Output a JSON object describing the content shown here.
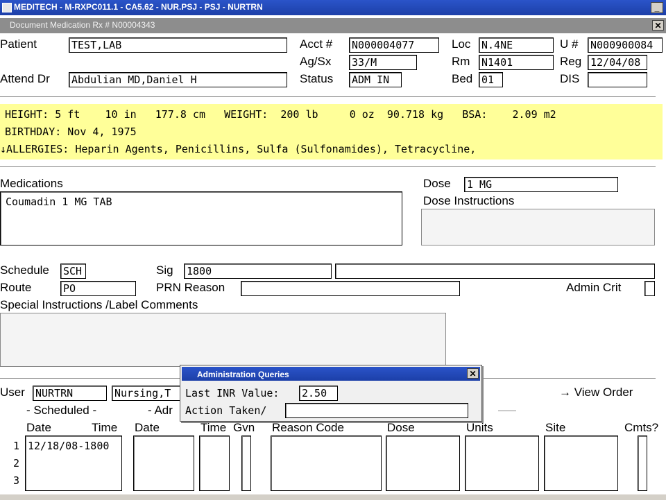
{
  "window": {
    "title": "MEDITECH - M-RXPC011.1 - CA5.62 - NUR.PSJ - PSJ - NURTRN",
    "subtitle": "Document Medication Rx # N00004343",
    "minimize_glyph": "_",
    "close_glyph": "✕"
  },
  "patient": {
    "patient_label": "Patient",
    "patient_value": "TEST,LAB",
    "acct_label": "Acct #",
    "acct_value": "N000004077",
    "loc_label": "Loc",
    "loc_value": "N.4NE",
    "u_label": "U #",
    "u_value": "N000900084",
    "agsx_label": "Ag/Sx",
    "agsx_value": "33/M",
    "rm_label": "Rm",
    "rm_value": "N1401",
    "reg_label": "Reg",
    "reg_value": "12/04/08",
    "attend_label": "Attend Dr",
    "attend_value": "Abdulian MD,Daniel H",
    "status_label": "Status",
    "status_value": "ADM IN",
    "bed_label": "Bed",
    "bed_value": "01",
    "dis_label": "DIS",
    "dis_value": ""
  },
  "banner": {
    "line1": "HEIGHT: 5 ft    10 in   177.8 cm   WEIGHT:  200 lb     0 oz  90.718 kg   BSA:    2.09 m2",
    "line2": "BIRTHDAY: Nov 4, 1975",
    "line3": "↓ALLERGIES: Heparin Agents, Penicillins, Sulfa (Sulfonamides), Tetracycline,"
  },
  "medication": {
    "medications_label": "Medications",
    "medications_value": "Coumadin 1 MG TAB",
    "dose_label": "Dose",
    "dose_value": "1 MG",
    "dose_instructions_label": "Dose Instructions",
    "dose_instructions_value": ""
  },
  "order": {
    "schedule_label": "Schedule",
    "schedule_value": "SCH",
    "sig_label": "Sig",
    "sig_value": "1800",
    "sig_extra": "",
    "route_label": "Route",
    "route_value": "PO",
    "prn_label": "PRN Reason",
    "prn_value": "",
    "admin_crit_label": "Admin Crit",
    "special_label": "Special Instructions /Label Comments",
    "special_value": ""
  },
  "admin": {
    "user_label": "User",
    "user_value": "NURTRN",
    "user_name_value": "Nursing,T",
    "view_order": "→ View Order",
    "scheduled_label": "- Scheduled -",
    "adr_label": "- Adr",
    "headers": {
      "date": "Date",
      "time": "Time",
      "date2": "Date",
      "time2": "Time",
      "gvn": "Gvn",
      "reason": "Reason Code",
      "dose": "Dose",
      "units": "Units",
      "site": "Site",
      "cmts": "Cmts?"
    },
    "row_numbers": [
      "1",
      "2",
      "3"
    ],
    "scheduled_rows": [
      "12/18/08-1800",
      "",
      ""
    ]
  },
  "dialog": {
    "title": "Administration Queries",
    "close_glyph": "✕",
    "inr_label": "Last INR Value:",
    "inr_value": "2.50",
    "action_label": "Action Taken/",
    "action_value": ""
  }
}
